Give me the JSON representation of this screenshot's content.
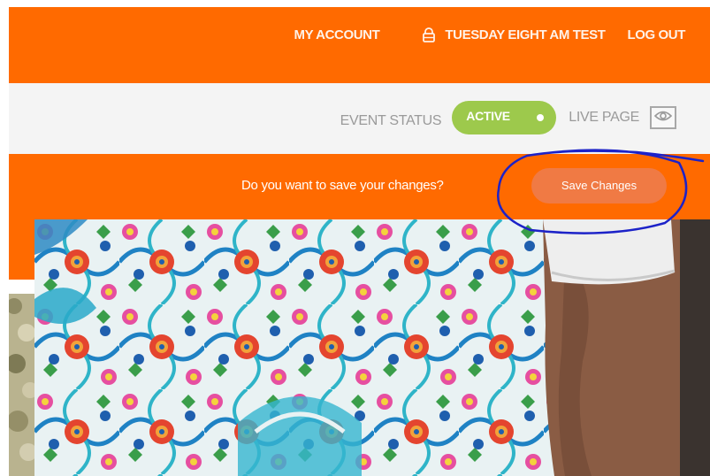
{
  "header": {
    "my_account": "MY ACCOUNT",
    "user_name": "TUESDAY EIGHT AM TEST",
    "log_out": "LOG OUT",
    "user_icon": "lock-icon"
  },
  "status": {
    "event_status_label": "EVENT STATUS",
    "toggle_label": "ACTIVE",
    "toggle_state": "on",
    "live_page_label": "LIVE PAGE",
    "live_page_icon": "eye-icon"
  },
  "save_bar": {
    "prompt": "Do you want to save your changes?",
    "button_label": "Save Changes"
  },
  "colors": {
    "brand_orange": "#ff6a00",
    "save_button": "#f07a44",
    "toggle_active": "#9dc94c",
    "status_bar_bg": "#f4f4f4",
    "annotation_ink": "#1c22c8"
  }
}
